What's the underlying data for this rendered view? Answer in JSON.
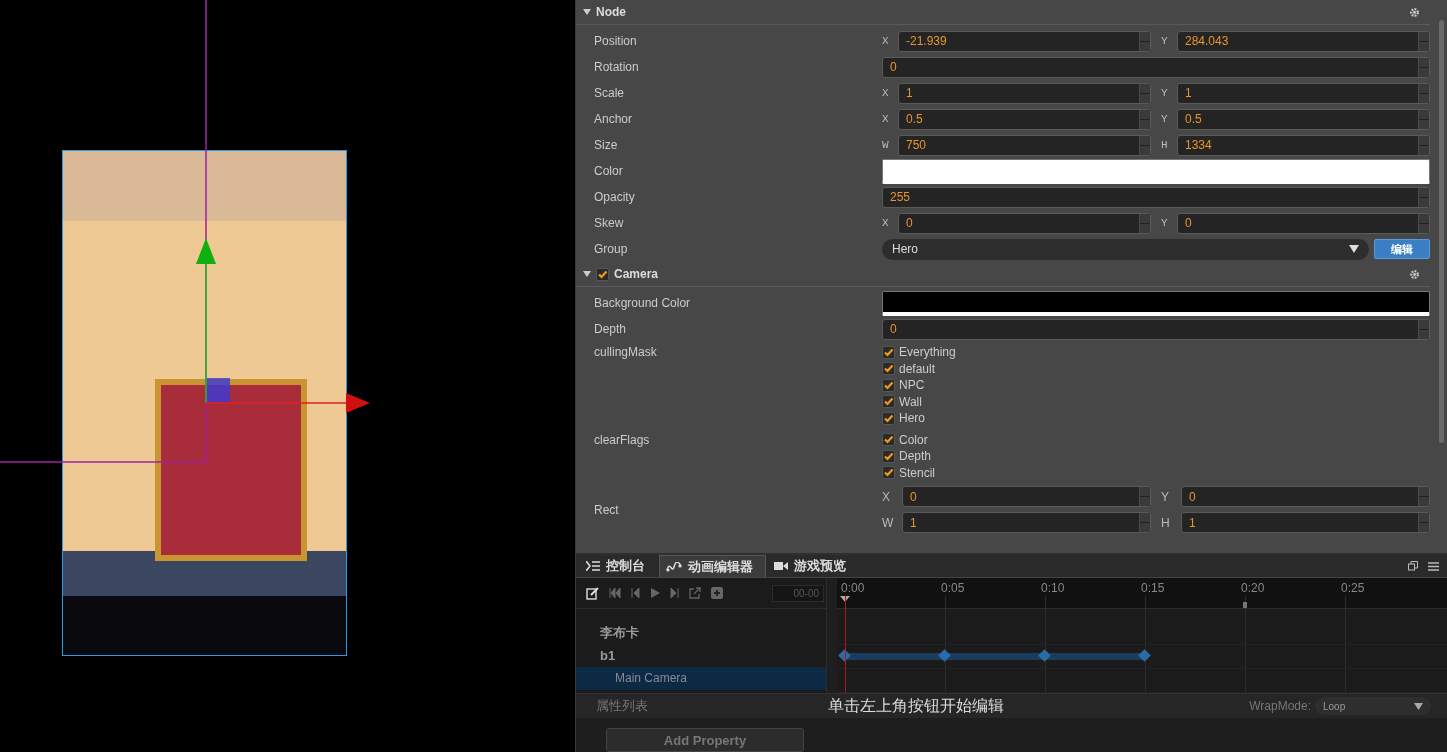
{
  "inspector": {
    "sections": [
      {
        "title": "Node",
        "properties": [
          {
            "kind": "pair",
            "label": "Position",
            "fields": [
              {
                "axis": "X",
                "value": "-21.939"
              },
              {
                "axis": "Y",
                "value": "284.043"
              }
            ]
          },
          {
            "kind": "number",
            "label": "Rotation",
            "value": "0"
          },
          {
            "kind": "pair",
            "label": "Scale",
            "fields": [
              {
                "axis": "X",
                "value": "1"
              },
              {
                "axis": "Y",
                "value": "1"
              }
            ]
          },
          {
            "kind": "pair",
            "label": "Anchor",
            "fields": [
              {
                "axis": "X",
                "value": "0.5"
              },
              {
                "axis": "Y",
                "value": "0.5"
              }
            ]
          },
          {
            "kind": "pair",
            "label": "Size",
            "fields": [
              {
                "axis": "W",
                "value": "750"
              },
              {
                "axis": "H",
                "value": "1334"
              }
            ]
          },
          {
            "kind": "color",
            "label": "Color",
            "color": "#ffffff"
          },
          {
            "kind": "number",
            "label": "Opacity",
            "value": "255"
          },
          {
            "kind": "pair",
            "label": "Skew",
            "fields": [
              {
                "axis": "X",
                "value": "0"
              },
              {
                "axis": "Y",
                "value": "0"
              }
            ]
          },
          {
            "kind": "select",
            "label": "Group",
            "value": "Hero",
            "button": "编辑"
          }
        ]
      },
      {
        "title": "Camera",
        "enabled": true,
        "properties": [
          {
            "kind": "color",
            "label": "Background Color",
            "color": "#000000"
          },
          {
            "kind": "number",
            "label": "Depth",
            "value": "0"
          },
          {
            "kind": "checklist",
            "label": "cullingMask",
            "options": [
              {
                "label": "Everything",
                "checked": true
              },
              {
                "label": "default",
                "checked": true
              },
              {
                "label": "NPC",
                "checked": true
              },
              {
                "label": "Wall",
                "checked": true
              },
              {
                "label": "Hero",
                "checked": true
              }
            ]
          },
          {
            "kind": "checklist",
            "label": "clearFlags",
            "options": [
              {
                "label": "Color",
                "checked": true
              },
              {
                "label": "Depth",
                "checked": true
              },
              {
                "label": "Stencil",
                "checked": true
              }
            ]
          },
          {
            "kind": "pairs",
            "label": "Rect",
            "rows": [
              [
                {
                  "axis": "X",
                  "value": "0"
                },
                {
                  "axis": "Y",
                  "value": "0"
                }
              ],
              [
                {
                  "axis": "W",
                  "value": "1"
                },
                {
                  "axis": "H",
                  "value": "1"
                }
              ]
            ]
          }
        ]
      }
    ]
  },
  "bottom_panel": {
    "tabs": [
      {
        "label": "控制台",
        "selected": false
      },
      {
        "label": "动画编辑器",
        "selected": true
      },
      {
        "label": "游戏预览",
        "selected": false
      }
    ],
    "time": "00-00",
    "ticks": [
      "0:00",
      "0:05",
      "0:10",
      "0:15",
      "0:20",
      "0:25"
    ],
    "tracks": [
      {
        "name": "李布卡",
        "selected": false
      },
      {
        "name": "b1",
        "selected": false,
        "keys": [
          true,
          true,
          true,
          true,
          false,
          false
        ],
        "children": [
          {
            "name": "Main Camera",
            "selected": true
          }
        ]
      }
    ],
    "properties_label": "属性列表",
    "hint": "单击左上角按钮开始编辑",
    "wrap_mode": {
      "label": "WrapMode:",
      "value": "Loop"
    },
    "add_property": "Add Property"
  }
}
